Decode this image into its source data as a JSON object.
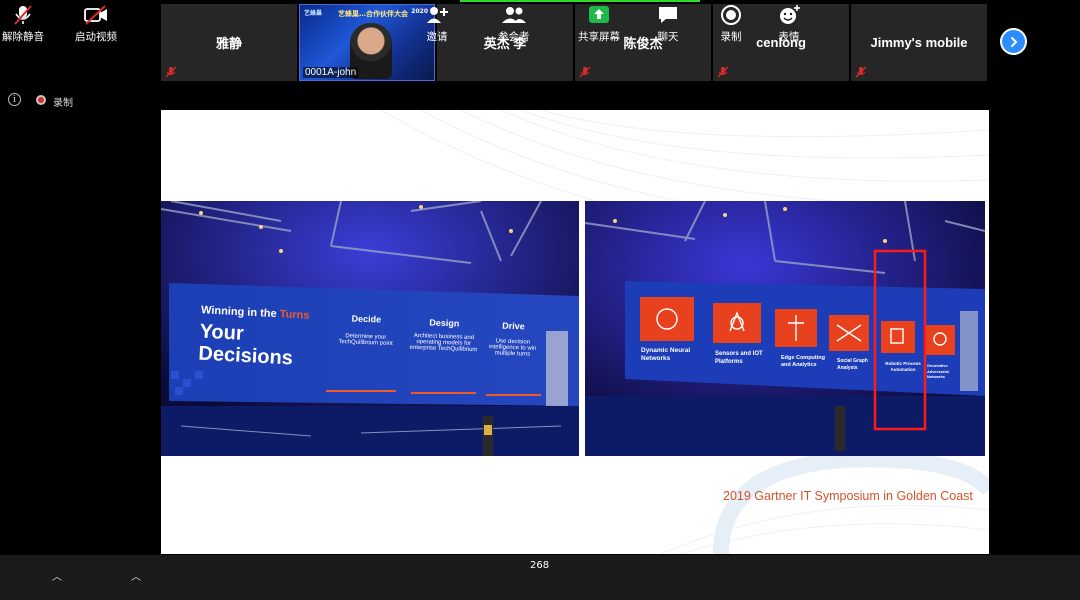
{
  "participants": [
    {
      "name": "雅静",
      "muted": true
    },
    {
      "name": "0001A-john",
      "video": true,
      "video_title": "艺蜂巢…合作伙伴大会",
      "video_year": "2020",
      "video_logo": "艺蜂巢"
    },
    {
      "name": "英杰 李",
      "muted": false
    },
    {
      "name": "陈俊杰",
      "muted": true
    },
    {
      "name": "cenlong",
      "muted": true
    },
    {
      "name": "Jimmy's mobile",
      "muted": true
    }
  ],
  "recording": {
    "label": "录制"
  },
  "slide": {
    "caption": "2019 Gartner IT Symposium in Golden Coast",
    "left_photo": {
      "headline_line1": "Winning in the",
      "headline_accent": "Turns",
      "headline_big1": "Your",
      "headline_big2": "Decisions",
      "columns": [
        {
          "title": "Decide",
          "text": "Determine your TechQuilibrium point"
        },
        {
          "title": "Design",
          "text": "Architect business and operating models for enterprise TechQuilibrium"
        },
        {
          "title": "Drive",
          "text": "Use decision intelligence to win multiple turns"
        }
      ]
    },
    "right_photo": {
      "tiles": [
        {
          "label": "Dynamic Neural Networks"
        },
        {
          "label": "Sensors and IOT Platforms"
        },
        {
          "label": "Edge Computing and Analytics"
        },
        {
          "label": "Social Graph Analysis"
        },
        {
          "label": "Robotic Process Automation"
        },
        {
          "label": "Generative Adversarial Networks"
        }
      ]
    }
  },
  "toolbar": {
    "unmute": "解除静音",
    "start_video": "启动视频",
    "invite": "邀请",
    "participants": "参会者",
    "participants_count": "268",
    "share_screen": "共享屏幕",
    "chat": "聊天",
    "record": "录制",
    "reactions": "表情"
  },
  "colors": {
    "accent_green": "#2bd92b",
    "zoom_blue": "#2d8cff",
    "caption_orange": "#d2532a",
    "share_green": "#1fb94a",
    "mute_red": "#e02a2a"
  }
}
